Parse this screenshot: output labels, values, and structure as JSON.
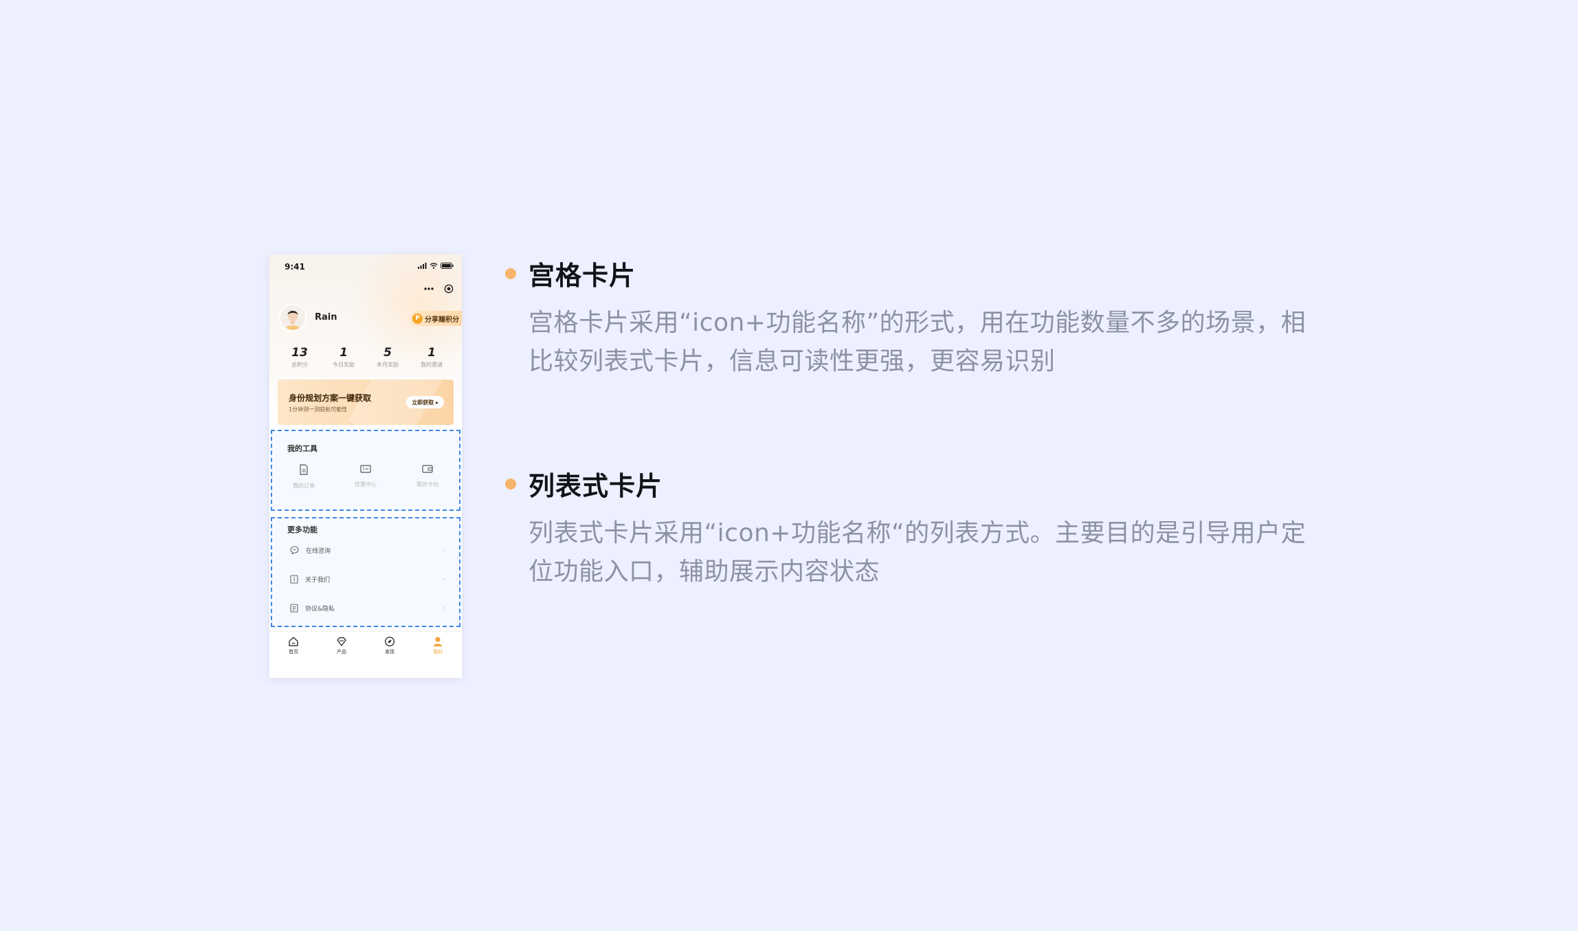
{
  "phone": {
    "status_time": "9:41",
    "user_name": "Rain",
    "share_label": "分享赚积分",
    "stats": [
      {
        "value": "13",
        "label": "总积分"
      },
      {
        "value": "1",
        "label": "今日奖励"
      },
      {
        "value": "5",
        "label": "本月奖励"
      },
      {
        "value": "1",
        "label": "我的邀请"
      }
    ],
    "banner": {
      "title": "身份规划方案一键获取",
      "subtitle": "1分钟测一测获批可能性",
      "button": "立即获取 ▸"
    },
    "tools": {
      "title": "我的工具",
      "items": [
        {
          "label": "我的订单",
          "icon": "order-icon"
        },
        {
          "label": "优惠中心",
          "icon": "coupon-icon"
        },
        {
          "label": "我的卡包",
          "icon": "wallet-icon"
        }
      ]
    },
    "more": {
      "title": "更多功能",
      "items": [
        {
          "label": "在线咨询",
          "icon": "chat-icon"
        },
        {
          "label": "关于我们",
          "icon": "info-icon"
        },
        {
          "label": "协议&隐私",
          "icon": "document-icon"
        }
      ],
      "chevron": "›"
    },
    "tabbar": [
      {
        "label": "首页",
        "icon": "home-icon"
      },
      {
        "label": "产品",
        "icon": "diamond-icon"
      },
      {
        "label": "发现",
        "icon": "compass-icon"
      },
      {
        "label": "我的",
        "icon": "user-icon"
      }
    ],
    "accent_color": "#f4a43a",
    "dash_color": "#3d86e6"
  },
  "sections": [
    {
      "title": "宫格卡片",
      "description": "宫格卡片采用“icon+功能名称”的形式，用在功能数量不多的场景，相比较列表式卡片，信息可读性更强，更容易识别"
    },
    {
      "title": "列表式卡片",
      "description": "列表式卡片采用“icon+功能名称“的列表方式。主要目的是引导用户定位功能入口，辅助展示内容状态"
    }
  ],
  "colors": {
    "background": "#edf0fe",
    "bullet": "#f7b46c",
    "title": "#111318",
    "description": "#8d92a2"
  }
}
